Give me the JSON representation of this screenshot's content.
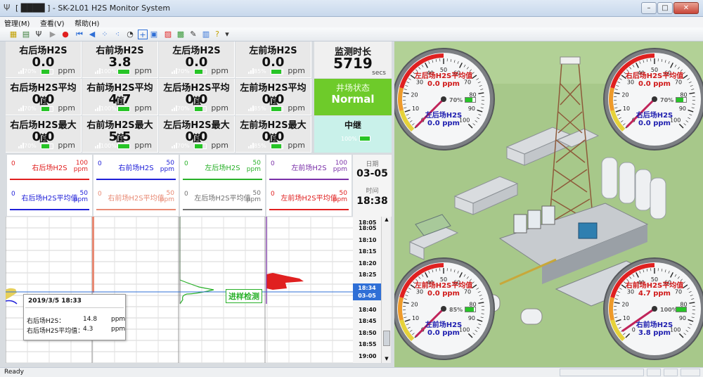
{
  "window": {
    "title": "[ ████ ] - SK-2L01 H2S Monitor System",
    "controls": [
      "–",
      "□",
      "✕"
    ]
  },
  "menu": [
    "管理(M)",
    "查看(V)",
    "帮助(H)"
  ],
  "colors": {
    "panel": "#e8e8e8",
    "normal_green": "#6ecb2a",
    "relay_teal": "#c9f1ea",
    "sel_blue": "#2f6fd6",
    "red": "#e02020",
    "blue": "#2020d8",
    "green": "#28b028",
    "purple": "#7a30a8",
    "salmon": "#e88a74",
    "gray": "#707070"
  },
  "metrics": [
    [
      {
        "label": "右后场H2S",
        "value": "0.0",
        "pct": "70%",
        "unit": "ppm"
      },
      {
        "label": "右前场H2S",
        "value": "3.8",
        "pct": "100%",
        "unit": "ppm"
      },
      {
        "label": "左后场H2S",
        "value": "0.0",
        "pct": "70%",
        "unit": "ppm"
      },
      {
        "label": "左前场H2S",
        "value": "0.0",
        "pct": "85%",
        "unit": "ppm"
      }
    ],
    [
      {
        "label": "右后场H2S平均值",
        "value": "0.0",
        "pct": "70%",
        "unit": "ppm"
      },
      {
        "label": "右前场H2S平均值",
        "value": "4.7",
        "pct": "100%",
        "unit": "ppm"
      },
      {
        "label": "左后场H2S平均值",
        "value": "0.0",
        "pct": "70%",
        "unit": "ppm"
      },
      {
        "label": "左前场H2S平均值",
        "value": "0.0",
        "pct": "85%",
        "unit": "ppm"
      }
    ],
    [
      {
        "label": "右后场H2S最大值",
        "value": "0.0",
        "pct": "70%",
        "unit": "ppm"
      },
      {
        "label": "右前场H2S最大值",
        "value": "5.5",
        "pct": "100%",
        "unit": "ppm"
      },
      {
        "label": "左后场H2S最大值",
        "value": "0.0",
        "pct": "70%",
        "unit": "ppm"
      },
      {
        "label": "左前场H2S最大值",
        "value": "0.0",
        "pct": "85%",
        "unit": "ppm"
      }
    ]
  ],
  "duration": {
    "label": "监测时长",
    "value": "5719",
    "unit": "secs"
  },
  "well": {
    "label": "井场状态",
    "status": "Normal"
  },
  "relay": {
    "label": "中继",
    "pct": "100%"
  },
  "channels_top": [
    {
      "lo": "0",
      "name": "右后场H2S",
      "hi": "100",
      "unit": "ppm",
      "color": "#e02020"
    },
    {
      "lo": "0",
      "name": "右前场H2S",
      "hi": "50",
      "unit": "ppm",
      "color": "#2020d8"
    },
    {
      "lo": "0",
      "name": "左后场H2S",
      "hi": "50",
      "unit": "ppm",
      "color": "#28b028"
    },
    {
      "lo": "0",
      "name": "左前场H2S",
      "hi": "100",
      "unit": "ppm",
      "color": "#7a30a8"
    }
  ],
  "channels_bottom": [
    {
      "lo": "0",
      "name": "右后场H2S平均值",
      "hi": "50",
      "unit": "ppm",
      "color": "#2020d8"
    },
    {
      "lo": "0",
      "name": "右前场H2S平均值",
      "hi": "50",
      "unit": "ppm",
      "color": "#e88a74"
    },
    {
      "lo": "0",
      "name": "左后场H2S平均值",
      "hi": "50",
      "unit": "ppm",
      "color": "#707070"
    },
    {
      "lo": "0",
      "name": "左前场H2S平均值",
      "hi": "50",
      "unit": "ppm",
      "color": "#e02020"
    }
  ],
  "date_box": {
    "date_label": "日期",
    "date": "03-05",
    "time_label": "时间",
    "time": "18:38"
  },
  "time_axis": [
    "18:05",
    "18:05",
    "18:10",
    "18:15",
    "18:20",
    "18:25",
    "18:30",
    "18:34",
    "18:40",
    "18:45",
    "18:50",
    "18:55",
    "19:00"
  ],
  "time_axis_selected": {
    "time": "18:34",
    "date": "03-05"
  },
  "overlay_label": "进样检测",
  "tooltip": {
    "title": "2019/3/5  18:33",
    "rows": [
      {
        "label": "右后场H2S：",
        "value": "14.8",
        "unit": "ppm"
      },
      {
        "label": "右后场H2S平均值：",
        "value": "4.3",
        "unit": "ppm"
      }
    ]
  },
  "gauges": [
    {
      "avg_label": "左后场H2S平均值",
      "avg_value": "0.0 ppm",
      "cur_label": "左后场H2S",
      "cur_value": "0.0 ppm",
      "pct": "70%",
      "ticks": [
        "0",
        "10",
        "20",
        "30",
        "40",
        "50",
        "60",
        "70",
        "80",
        "90",
        "100"
      ]
    },
    {
      "avg_label": "右后场H2S平均值",
      "avg_value": "0.0 ppm",
      "cur_label": "右后场H2S",
      "cur_value": "0.0 ppm",
      "pct": "70%",
      "ticks": [
        "0",
        "10",
        "20",
        "30",
        "40",
        "50",
        "60",
        "70",
        "80",
        "90",
        "100"
      ]
    },
    {
      "avg_label": "左前场H2S平均值",
      "avg_value": "0.0 ppm",
      "cur_label": "左前场H2S",
      "cur_value": "0.0 ppm",
      "pct": "85%",
      "ticks": [
        "0",
        "10",
        "20",
        "30",
        "40",
        "50",
        "60",
        "70",
        "80",
        "90",
        "100"
      ]
    },
    {
      "avg_label": "右前场H2S平均值",
      "avg_value": "4.7 ppm",
      "cur_label": "右前场H2S",
      "cur_value": "3.8 ppm",
      "pct": "100%",
      "ticks": [
        "0",
        "10",
        "20",
        "30",
        "40",
        "50",
        "60",
        "70",
        "80",
        "90",
        "100"
      ]
    }
  ],
  "status_bar": {
    "text": "Ready"
  }
}
